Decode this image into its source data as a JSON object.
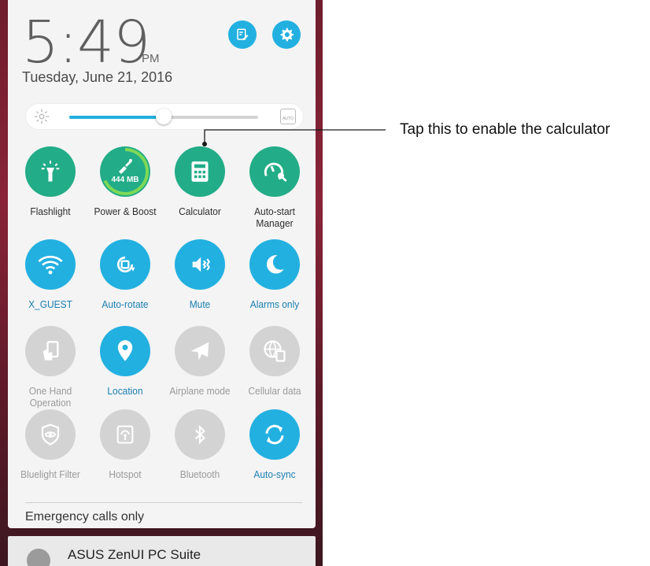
{
  "status": {
    "time": "5:49",
    "ampm": "PM",
    "date": "Tuesday, June 21, 2016"
  },
  "header_buttons": [
    {
      "icon": "notes-edit-icon"
    },
    {
      "icon": "settings-gear-icon"
    }
  ],
  "brightness": {
    "level_fraction": 0.5,
    "icon_left": "brightness-sun-icon",
    "auto_label": "AUTO"
  },
  "tiles": [
    {
      "label": "Flashlight",
      "icon": "flashlight-icon",
      "color": "#22ac87",
      "state": "on"
    },
    {
      "label": "Power & Boost",
      "icon": "broom-boost-icon",
      "color": "#22ac87",
      "state": "on",
      "badge": "444 MB"
    },
    {
      "label": "Calculator",
      "icon": "calculator-icon",
      "color": "#22ac87",
      "state": "on"
    },
    {
      "label": "Auto-start Manager",
      "icon": "auto-start-icon",
      "color": "#22ac87",
      "state": "on"
    },
    {
      "label": "X_GUEST",
      "icon": "wifi-icon",
      "color": "#22b0e0",
      "state": "on"
    },
    {
      "label": "Auto-rotate",
      "icon": "auto-rotate-icon",
      "color": "#22b0e0",
      "state": "on"
    },
    {
      "label": "Mute",
      "icon": "vibrate-speaker-icon",
      "color": "#22b0e0",
      "state": "on"
    },
    {
      "label": "Alarms only",
      "icon": "moon-icon",
      "color": "#22b0e0",
      "state": "on"
    },
    {
      "label": "One Hand Operation",
      "icon": "one-hand-icon",
      "color": "#d3d3d3",
      "state": "off"
    },
    {
      "label": "Location",
      "icon": "location-pin-icon",
      "color": "#22b0e0",
      "state": "on"
    },
    {
      "label": "Airplane mode",
      "icon": "airplane-icon",
      "color": "#d3d3d3",
      "state": "off"
    },
    {
      "label": "Cellular data",
      "icon": "cellular-data-icon",
      "color": "#d3d3d3",
      "state": "off"
    },
    {
      "label": "Bluelight Filter",
      "icon": "eye-shield-icon",
      "color": "#d3d3d3",
      "state": "off"
    },
    {
      "label": "Hotspot",
      "icon": "hotspot-icon",
      "color": "#d3d3d3",
      "state": "off"
    },
    {
      "label": "Bluetooth",
      "icon": "bluetooth-icon",
      "color": "#d3d3d3",
      "state": "off"
    },
    {
      "label": "Auto-sync",
      "icon": "sync-icon",
      "color": "#22b0e0",
      "state": "on"
    }
  ],
  "footer": {
    "emergency": "Emergency calls only"
  },
  "notification": {
    "title": "ASUS ZenUI PC Suite"
  },
  "callout": {
    "text": "Tap this to enable the calculator"
  },
  "colors": {
    "accent_blue": "#22b0e0",
    "accent_green": "#22ac87",
    "disabled": "#d3d3d3"
  }
}
